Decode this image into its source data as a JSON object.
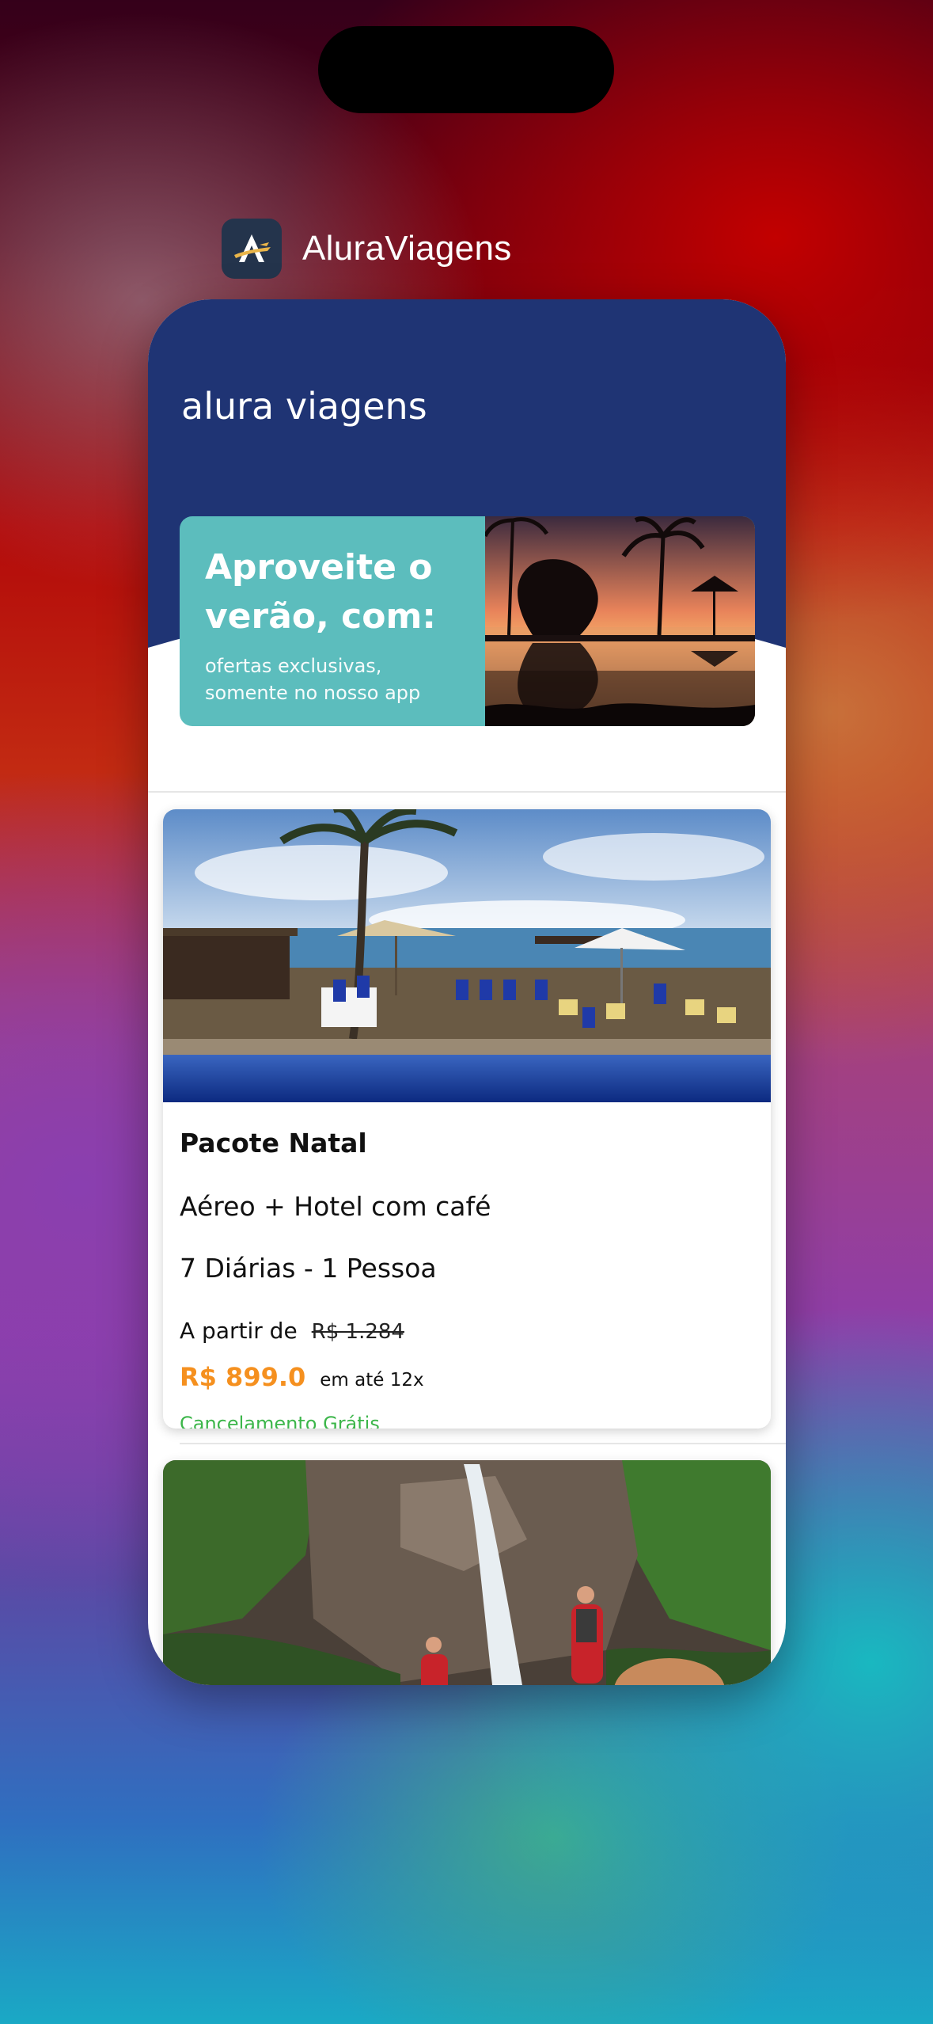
{
  "app_switcher": {
    "app_name": "AluraViagens",
    "icon": "alura-plane-logo-icon"
  },
  "app": {
    "brand_title": "alura viagens",
    "promo": {
      "heading": "Aproveite o verão, com:",
      "subtitle": "ofertas exclusivas, somente no nosso app",
      "image": "sunset-palm-trees-pool-image"
    },
    "packages": [
      {
        "image": "beach-resort-pool-image",
        "title": "Pacote Natal",
        "detail1": "Aéreo + Hotel com café",
        "detail2": "7 Diárias - 1 Pessoa",
        "from_label": "A partir de",
        "old_price": "R$ 1.284",
        "price": "R$ 899.0",
        "installments": "em até 12x",
        "cancellation": "Cancelamento Grátis"
      },
      {
        "image": "waterfall-hikers-image"
      }
    ]
  },
  "colors": {
    "header_navy": "#1f3474",
    "promo_teal": "#5cbdbd",
    "price_orange": "#f5901f",
    "cancel_green": "#3cb64a"
  }
}
